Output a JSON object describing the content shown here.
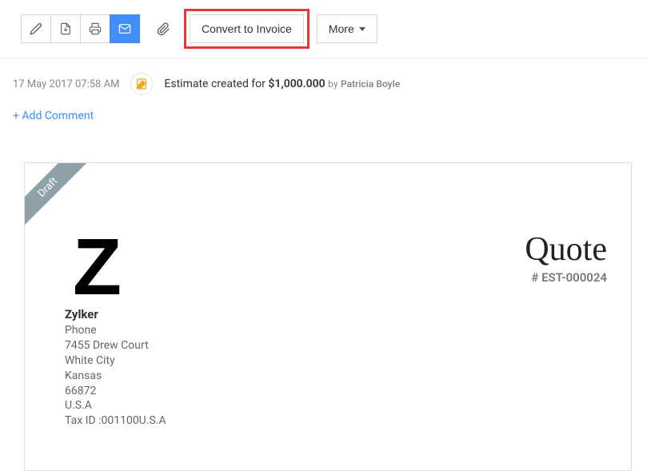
{
  "toolbar": {
    "convert_label": "Convert to Invoice",
    "more_label": "More"
  },
  "activity": {
    "timestamp": "17 May 2017 07:58 AM",
    "prefix": "Estimate created for",
    "amount": "$1,000.000",
    "by_label": "by",
    "user": "Patricia Boyle"
  },
  "comments": {
    "add_label": "+ Add Comment"
  },
  "document": {
    "status": "Draft",
    "title": "Quote",
    "number": "# EST-000024",
    "logo_letter": "Z",
    "company": {
      "name": "Zylker",
      "phone": "Phone",
      "street": "7455 Drew Court",
      "city": "White City",
      "state": "Kansas",
      "zip": "66872",
      "country": "U.S.A",
      "tax": "Tax ID :001100U.S.A"
    }
  }
}
